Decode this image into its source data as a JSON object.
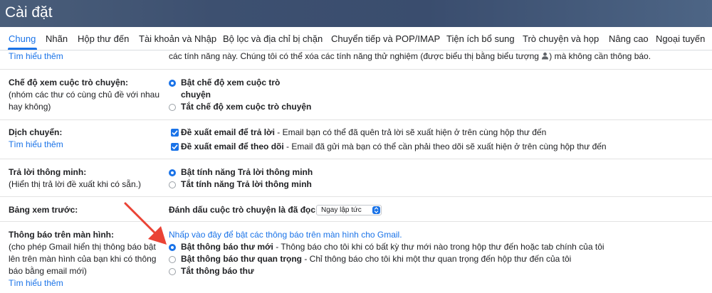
{
  "header": {
    "title": "Cài đặt"
  },
  "tabs": [
    {
      "label": "Chung"
    },
    {
      "label": "Nhãn"
    },
    {
      "label": "Hộp thư đến"
    },
    {
      "label": "Tài khoản và Nhập"
    },
    {
      "label": "Bộ lọc và địa chỉ bị chặn"
    },
    {
      "label": "Chuyển tiếp và POP/IMAP"
    },
    {
      "label": "Tiện ích bổ sung"
    },
    {
      "label": "Trò chuyện và họp"
    },
    {
      "label": "Nâng cao"
    },
    {
      "label": "Ngoại tuyến"
    }
  ],
  "active_tab_index": 0,
  "top_partial": {
    "learn_more": "Tìm hiểu thêm",
    "text_before": "các tính năng này. Chúng tôi có thể xóa các tính năng thử nghiệm (được biểu thị bằng biểu tượng ",
    "text_after": ") mà không cần thông báo."
  },
  "conversation_view": {
    "title": "Chế độ xem cuộc trò chuyện:",
    "desc_1": "(nhóm các thư có cùng chủ đề với nhau",
    "desc_2": "hay không)",
    "option_on_1": "Bật chế độ xem cuộc trò",
    "option_on_2": "chuyện",
    "option_off": "Tắt chế độ xem cuộc trò chuyện",
    "selected": "on"
  },
  "nudges": {
    "title": "Dịch chuyển:",
    "learn_more": "Tìm hiểu thêm",
    "opt1_bold": "Đề xuất email để trả lời",
    "opt1_rest": " - Email bạn có thể đã quên trả lời sẽ xuất hiện ở trên cùng hộp thư đến",
    "opt2_bold": "Đề xuất email để theo dõi",
    "opt2_rest": " - Email đã gửi mà bạn có thể cần phải theo dõi sẽ xuất hiện ở trên cùng hộp thư đến",
    "opt1_checked": true,
    "opt2_checked": true
  },
  "smart_reply": {
    "title": "Trả lời thông minh:",
    "desc": "(Hiển thị trả lời đề xuất khi có sẵn.)",
    "option_on": "Bật tính năng Trả lời thông minh",
    "option_off": "Tắt tính năng Trả lời thông minh",
    "selected": "on"
  },
  "preview_pane": {
    "title": "Bảng xem trước:",
    "mark_read_label": "Đánh dấu cuộc trò chuyện là đã đọc:",
    "mark_read_value": "Ngay lập tức"
  },
  "desktop_notifications": {
    "title": "Thông báo trên màn hình:",
    "desc_1": "(cho phép Gmail hiển thị thông báo bật",
    "desc_2": "lên trên màn hình của bạn khi có thông",
    "desc_3": "báo bằng email mới)",
    "learn_more": "Tìm hiểu thêm",
    "enable_link": "Nhấp vào đây để bật các thông báo trên màn hình cho Gmail.",
    "opt_new_bold": "Bật thông báo thư mới",
    "opt_new_rest": " - Thông báo cho tôi khi có bất kỳ thư mới nào trong hộp thư đến hoặc tab chính của tôi",
    "opt_important_bold": "Bật thông báo thư quan trọng",
    "opt_important_rest": " - Chỉ thông báo cho tôi khi một thư quan trọng đến hộp thư đến của tôi",
    "opt_off": "Tắt thông báo thư",
    "selected": "new"
  },
  "colors": {
    "accent": "#1a73e8",
    "arrow": "#ea4335"
  }
}
